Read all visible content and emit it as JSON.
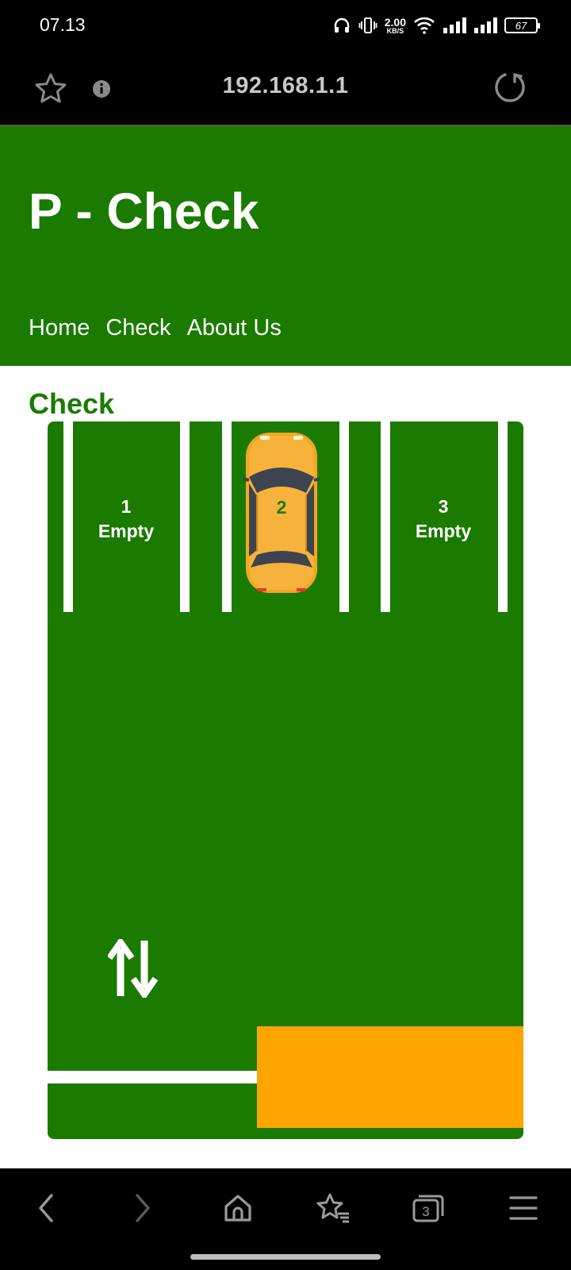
{
  "status_bar": {
    "time": "07.13",
    "net_speed_value": "2.00",
    "net_speed_unit": "KB/S",
    "battery": "67",
    "icons": [
      "headphones-icon",
      "vibrate-icon",
      "wifi-icon",
      "signal-icon",
      "signal-icon",
      "battery-icon"
    ]
  },
  "browser": {
    "url": "192.168.1.1",
    "tab_count": "3"
  },
  "site": {
    "title": "P - Check",
    "nav": [
      "Home",
      "Check",
      "About Us"
    ],
    "section_title": "Check"
  },
  "parking": {
    "slots": [
      {
        "number": "1",
        "status": "Empty",
        "occupied": false
      },
      {
        "number": "2",
        "status": "",
        "occupied": true
      },
      {
        "number": "3",
        "status": "Empty",
        "occupied": false
      }
    ]
  },
  "colors": {
    "brand_green": "#1b7a00",
    "exit_orange": "#ffa500",
    "car_yellow": "#f5a623"
  }
}
